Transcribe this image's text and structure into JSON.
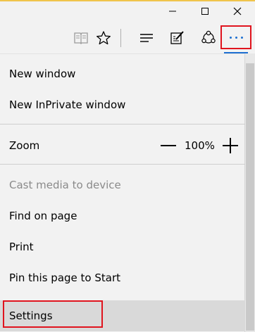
{
  "window_controls": {
    "minimize": "minimize",
    "maximize": "maximize",
    "close": "close"
  },
  "toolbar": {
    "icons": [
      "reading-view-icon",
      "favorite-star-icon",
      "hub-icon",
      "web-note-icon",
      "share-icon",
      "more-actions-icon"
    ]
  },
  "menu": {
    "new_window": "New window",
    "new_inprivate": "New InPrivate window",
    "zoom_label": "Zoom",
    "zoom_value": "100%",
    "cast_media": "Cast media to device",
    "find_on_page": "Find on page",
    "print": "Print",
    "pin_to_start": "Pin this page to Start",
    "settings": "Settings"
  },
  "colors": {
    "accent": "#1d6fd1",
    "highlight_border": "#e0141e",
    "menu_bg": "#f2f2f2",
    "hover_bg": "#d9d9d9"
  }
}
